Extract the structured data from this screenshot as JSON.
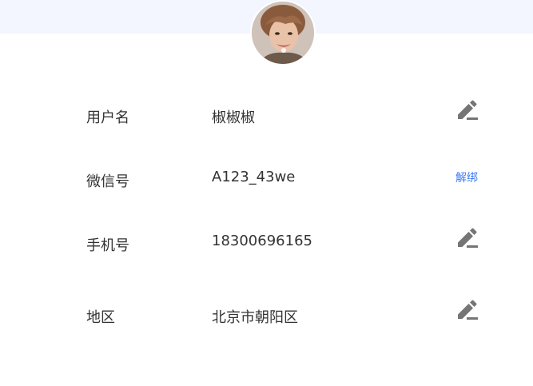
{
  "profile": {
    "avatar_icon": "user-avatar-photo",
    "edit_icon": "pencil-edit-icon",
    "rows": [
      {
        "label": "用户名",
        "value": "椒椒椒",
        "action": "edit"
      },
      {
        "label": "微信号",
        "value": "A123_43we",
        "action": "unbind",
        "action_label": "解绑"
      },
      {
        "label": "手机号",
        "value": "18300696165",
        "action": "edit"
      },
      {
        "label": "地区",
        "value": "北京市朝阳区",
        "action": "edit"
      }
    ]
  },
  "colors": {
    "header_band": "#f3f6fe",
    "link": "#3f7bf6",
    "icon": "#757575",
    "text": "#333333"
  }
}
